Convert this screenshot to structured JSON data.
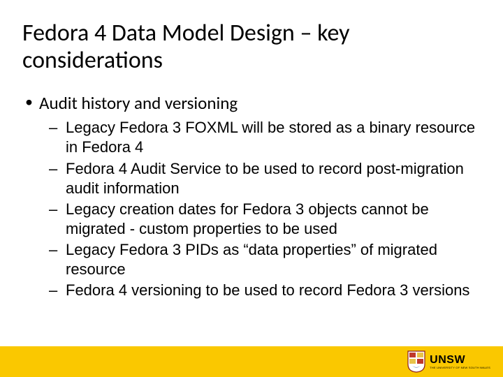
{
  "title": "Fedora 4 Data Model Design – key considerations",
  "bullets": {
    "lvl1": "Audit history and versioning",
    "lvl2": [
      "Legacy Fedora 3 FOXML will be stored as a binary resource in Fedora 4",
      "Fedora 4 Audit Service to be used to record post-migration audit information",
      "Legacy creation dates for Fedora 3 objects cannot be migrated - custom properties to be used",
      "Legacy Fedora 3 PIDs as “data properties” of migrated resource",
      "Fedora 4 versioning to be used to record Fedora 3 versions"
    ]
  },
  "footer": {
    "logo_text": "UNSW",
    "logo_sub": "THE UNIVERSITY OF NEW SOUTH WALES",
    "accent_color": "#fac800"
  }
}
